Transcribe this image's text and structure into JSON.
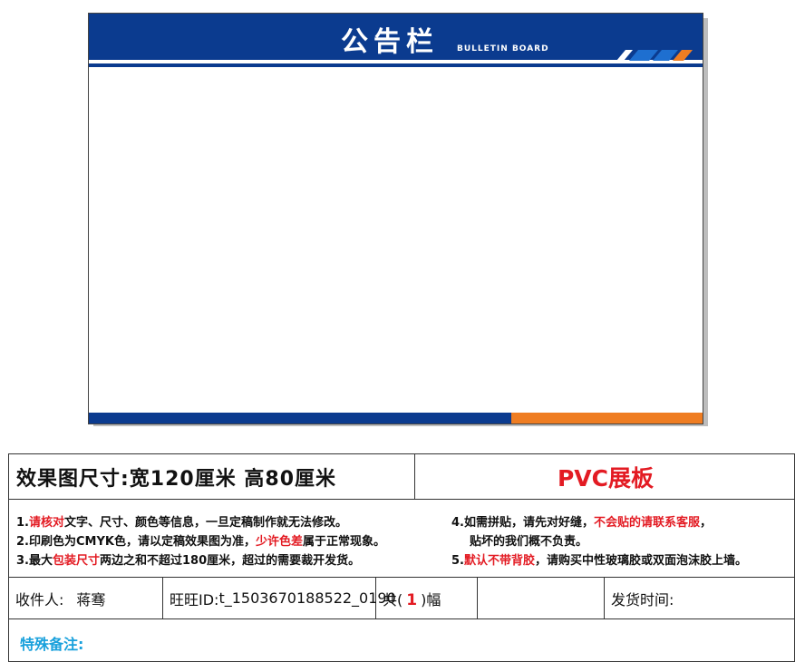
{
  "board": {
    "title": "公告栏",
    "subtitle": "BULLETIN BOARD",
    "colors": {
      "primary_blue": "#0b3b8f",
      "accent_orange": "#ef7d22"
    }
  },
  "spec": {
    "size_text": "效果图尺寸:宽120厘米  高80厘米",
    "product": "PVC展板"
  },
  "notes": {
    "n1": {
      "prefix": "1.",
      "highlight": "请核对",
      "rest": "文字、尺寸、颜色等信息，一旦定稿制作就无法修改。"
    },
    "n2": {
      "prefix": "2.印刷色为CMYK色，请以定稿效果图为准，",
      "highlight": "少许色差",
      "rest": "属于正常现象。"
    },
    "n3": {
      "prefix": "3.最大",
      "highlight": "包装尺寸",
      "rest": "两边之和不超过180厘米，超过的需要裁开发货。"
    },
    "n4": {
      "prefix": "4.如需拼贴，请先对好缝，",
      "highlight": "不会贴的请联系客服",
      "rest": "，"
    },
    "n4b": {
      "text": "贴坏的我们概不负责。"
    },
    "n5": {
      "prefix": "5.",
      "highlight": "默认不带背胶",
      "rest": "，请购买中性玻璃胶或双面泡沫胶上墙。"
    }
  },
  "order": {
    "recipient_label": "收件人:",
    "recipient_name": "蒋骞",
    "wangwang_label": "旺旺ID:",
    "wangwang_id": "t_1503670188522_0190",
    "qty_prefix": "共(",
    "qty_value": "1",
    "qty_suffix": ")幅",
    "ship_time_label": "发货时间:"
  },
  "remark": {
    "label": "特殊备注:"
  }
}
